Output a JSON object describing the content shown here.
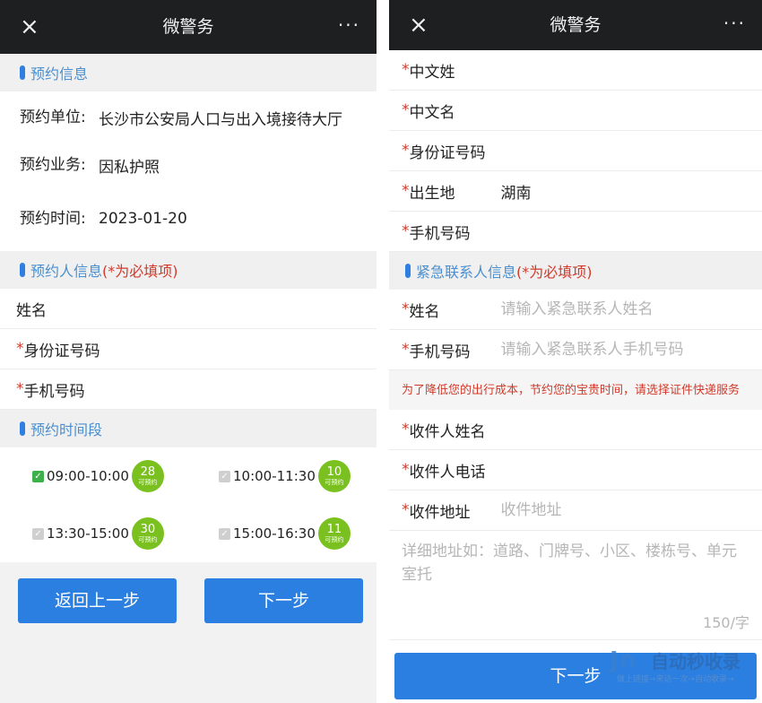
{
  "left": {
    "topbar": {
      "close": "×",
      "title": "微警务",
      "more": "···"
    },
    "appointment": {
      "section_title": "预约信息",
      "rows": [
        {
          "label": "预约单位:",
          "value": "长沙市公安局人口与出入境接待大厅"
        },
        {
          "label": "预约业务:",
          "value": "因私护照"
        },
        {
          "label": "预约时间:",
          "value": "2023-01-20"
        }
      ]
    },
    "applicant": {
      "section_title": "预约人信息",
      "required_note": "(*为必填项)",
      "fields": [
        {
          "star": "",
          "label": " 姓名"
        },
        {
          "star": "*",
          "label": "身份证号码"
        },
        {
          "star": "*",
          "label": "手机号码"
        }
      ]
    },
    "slots": {
      "section_title": "预约时间段",
      "items": [
        {
          "time": "09:00-10:00",
          "count": "28",
          "sub": "可预约",
          "checked": true
        },
        {
          "time": "10:00-11:30",
          "count": "10",
          "sub": "可预约",
          "checked": false
        },
        {
          "time": "13:30-15:00",
          "count": "30",
          "sub": "可预约",
          "checked": false
        },
        {
          "time": "15:00-16:30",
          "count": "11",
          "sub": "可预约",
          "checked": false
        }
      ]
    },
    "buttons": {
      "back": "返回上一步",
      "next": "下一步"
    }
  },
  "right": {
    "topbar": {
      "close": "×",
      "title": "微警务",
      "more": "···"
    },
    "fields_top": [
      {
        "star": "*",
        "label": "中文姓",
        "value": ""
      },
      {
        "star": "*",
        "label": "中文名",
        "value": ""
      },
      {
        "star": "*",
        "label": "身份证号码",
        "value": ""
      },
      {
        "star": "*",
        "label": "出生地",
        "value": "湖南"
      },
      {
        "star": "*",
        "label": "手机号码",
        "value": ""
      }
    ],
    "emergency": {
      "section_title": "紧急联系人信息",
      "required_note": "(*为必填项)",
      "fields": [
        {
          "star": "*",
          "label": "姓名",
          "placeholder": "请输入紧急联系人姓名"
        },
        {
          "star": "*",
          "label": "手机号码",
          "placeholder": "请输入紧急联系人手机号码"
        }
      ]
    },
    "notice": "为了降低您的出行成本，节约您的宝贵时间，请选择证件快递服务",
    "mail_fields": [
      {
        "star": "*",
        "label": "收件人姓名",
        "placeholder": ""
      },
      {
        "star": "*",
        "label": "收件人电话",
        "placeholder": ""
      },
      {
        "star": "*",
        "label": "收件地址",
        "placeholder": "收件地址"
      }
    ],
    "address_detail_placeholder": "详细地址如：道路、门牌号、小区、楼栋号、单元室托",
    "counter": "150/字",
    "next_button": "下一步"
  },
  "watermark": {
    "main": "自动秒收录",
    "sub": "做上链接→来访一次→自动收录→"
  }
}
